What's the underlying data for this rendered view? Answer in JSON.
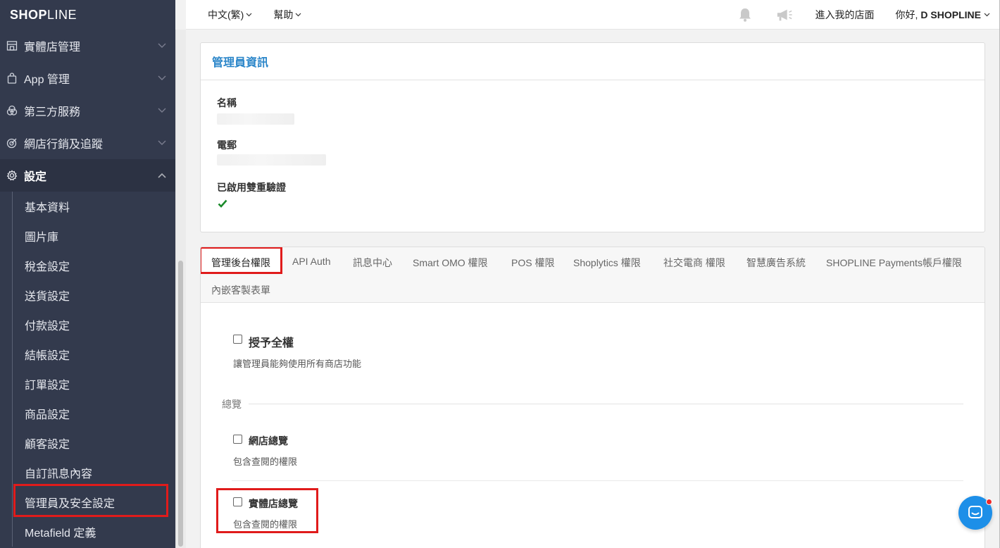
{
  "brand": {
    "logo_bold": "SHOP",
    "logo_thin": "LINE"
  },
  "sidebar": {
    "items": [
      {
        "label": "實體店管理",
        "icon": "store-icon"
      },
      {
        "label": "App 管理",
        "icon": "bag-icon"
      },
      {
        "label": "第三方服務",
        "icon": "circles-icon"
      },
      {
        "label": "網店行銷及追蹤",
        "icon": "target-icon"
      },
      {
        "label": "設定",
        "icon": "gear-icon"
      }
    ],
    "sub_items": [
      "基本資料",
      "圖片庫",
      "稅金設定",
      "送貨設定",
      "付款設定",
      "結帳設定",
      "訂單設定",
      "商品設定",
      "顧客設定",
      "自訂訊息內容",
      "管理員及安全設定",
      "Metafield 定義"
    ]
  },
  "topbar": {
    "language": "中文(繁)",
    "help": "幫助",
    "store_link": "進入我的店面",
    "greeting": "你好,",
    "user": "D SHOPLINE"
  },
  "admin_info": {
    "title": "管理員資訊",
    "name_label": "名稱",
    "email_label": "電郵",
    "two_factor_label": "已啟用雙重驗證"
  },
  "tabs": [
    "管理後台權限",
    "API Auth",
    "訊息中心",
    "Smart OMO 權限",
    "POS 權限",
    "Shoplytics 權限",
    "社交電商 權限",
    "智慧廣告系統",
    "SHOPLINE Payments帳戶權限",
    "內嵌客製表單"
  ],
  "permissions": {
    "full_access": {
      "title": "授予全權",
      "desc": "讓管理員能夠使用所有商店功能"
    },
    "section_overview": "總覽",
    "online_overview": {
      "title": "網店總覽",
      "desc": "包含查閱的權限"
    },
    "retail_overview": {
      "title": "實體店總覽",
      "desc": "包含查閱的權限"
    }
  },
  "colors": {
    "sidebar_bg": "#333a4d",
    "link_blue": "#2b86c9",
    "highlight_red": "#e01b1b",
    "check_green": "#1a8a2a",
    "chat_blue": "#1d8fe8"
  }
}
